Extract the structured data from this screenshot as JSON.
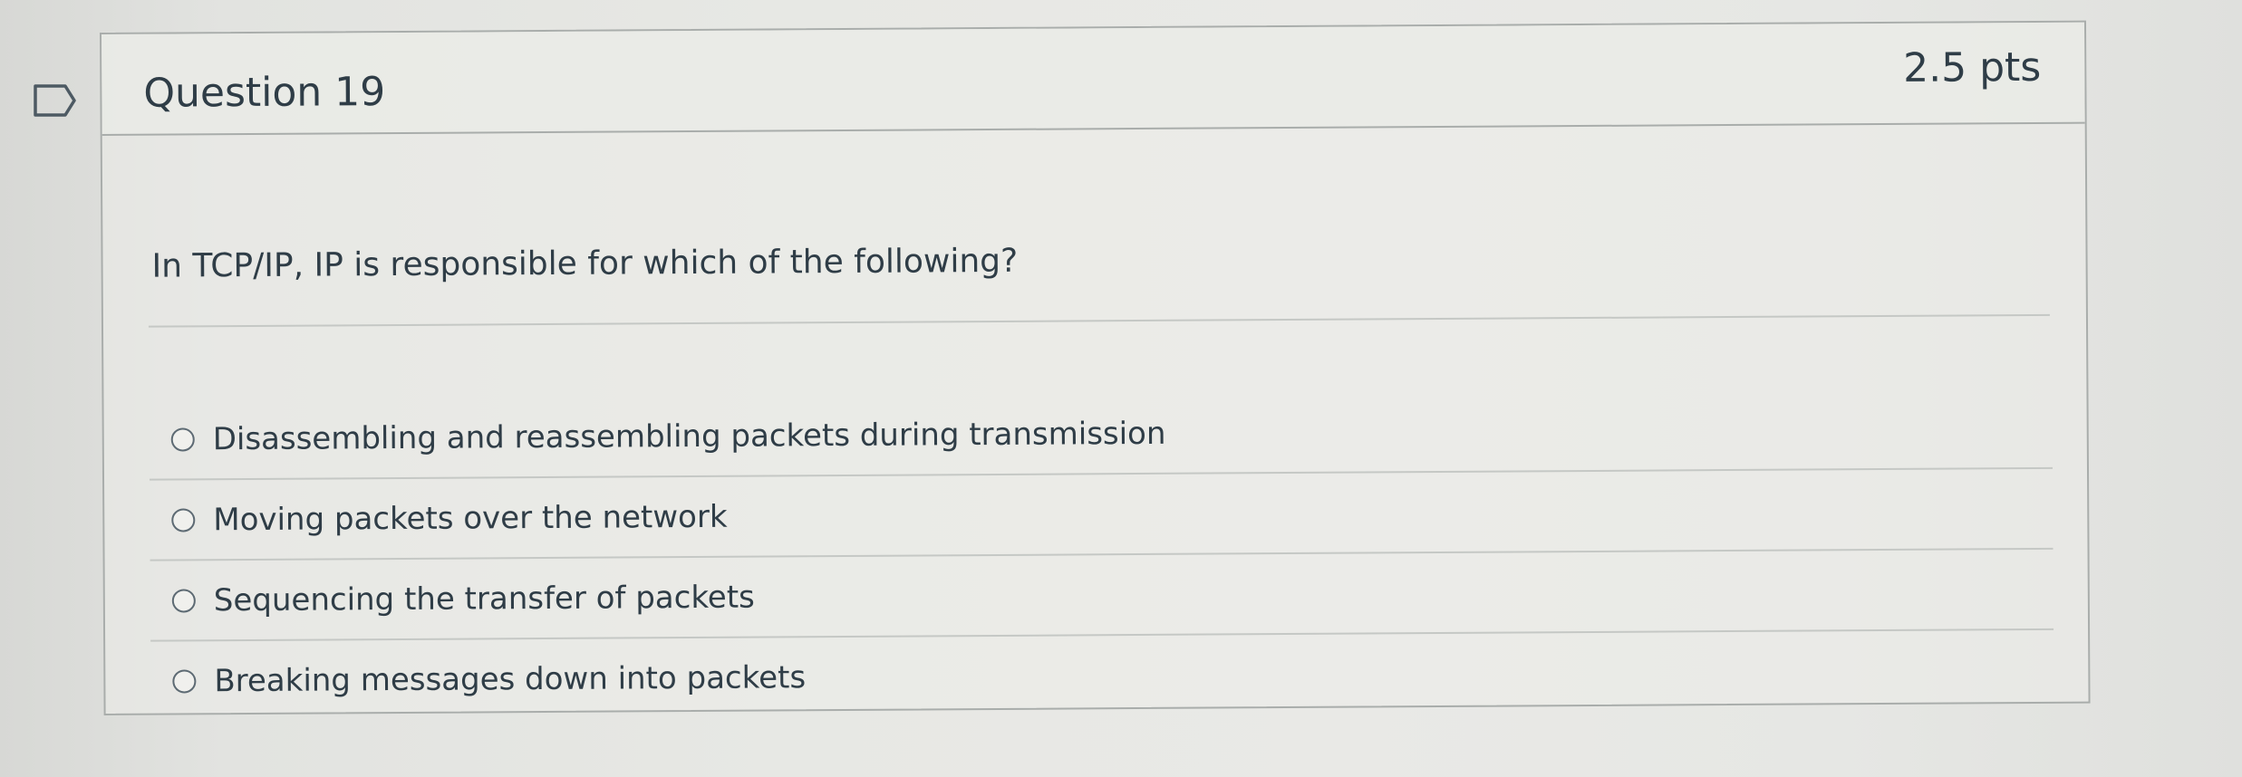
{
  "question": {
    "title": "Question 19",
    "points": "2.5 pts",
    "flag_icon": "flag-outline-icon",
    "text": "In TCP/IP, IP is responsible for which of the following?",
    "answers": [
      {
        "label": "Disassembling and reassembling packets during transmission",
        "selected": false
      },
      {
        "label": "Moving packets over the network",
        "selected": false
      },
      {
        "label": "Sequencing the transfer of packets",
        "selected": false
      },
      {
        "label": "Breaking messages down into packets",
        "selected": false
      }
    ]
  },
  "colors": {
    "text": "#2f3d47",
    "border": "#a9adab",
    "divider": "#c5c8c5",
    "radio_border": "#5d6a73"
  }
}
